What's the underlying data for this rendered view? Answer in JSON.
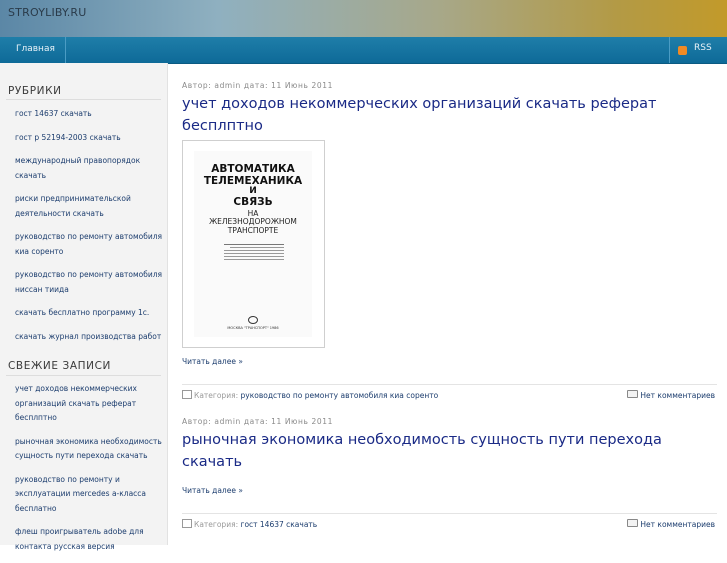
{
  "site": {
    "title": "STROYLIBY.RU"
  },
  "nav": {
    "home": "Главная",
    "rss": "RSS"
  },
  "sidebar": {
    "rubrics_heading": "РУБРИКИ",
    "rubrics": [
      "гост 14637 скачать",
      "гост р 52194-2003 скачать",
      "международный правопорядок скачать",
      "риски предпринимательской деятельности скачать",
      "руководство по ремонту автомобиля киа соренто",
      "руководство по ремонту автомобиля ниссан тиида",
      "скачать бесплатно программу 1с.",
      "скачать журнал производства работ"
    ],
    "recent_heading": "СВЕЖИЕ ЗАПИСИ",
    "recent": [
      "учет доходов некоммерческих организаций скачать реферат бесплптно",
      "рыночная экономика необходимость сущность пути перехода скачать",
      "руководство по ремонту и эксплуатации mercedes a-класса бесплатно",
      "флеш проигрыватель adobe для контакта русская версия"
    ]
  },
  "posts": [
    {
      "meta": "Автор: admin дата: 11 Июнь 2011",
      "title": "учет доходов некоммерческих организаций скачать реферат бесплптно",
      "read_more": "Читать далее »",
      "category_label": "Категория:",
      "category": "руководство по ремонту автомобиля киа соренто",
      "comments": "Нет комментариев"
    },
    {
      "meta": "Автор: admin дата: 11 Июнь 2011",
      "title": "рыночная экономика необходимость сущность пути перехода скачать",
      "read_more": "Читать далее »",
      "category_label": "Категория:",
      "category": "гост 14637 скачать",
      "comments": "Нет комментариев"
    }
  ],
  "book": {
    "line1": "АВТОМАТИКА",
    "line2": "ТЕЛЕМЕХАНИКА",
    "line3": "И",
    "line4": "СВЯЗЬ",
    "line5": "НА",
    "line6": "ЖЕЛЕЗНОДОРОЖНОМ",
    "line7": "ТРАНСПОРТЕ",
    "publisher": "МОСКВА \"ТРАНСПОРТ\" 1986"
  },
  "colors": {
    "nav": "#0e6a98",
    "link": "#1c3d6e",
    "title": "#1a2a86"
  }
}
